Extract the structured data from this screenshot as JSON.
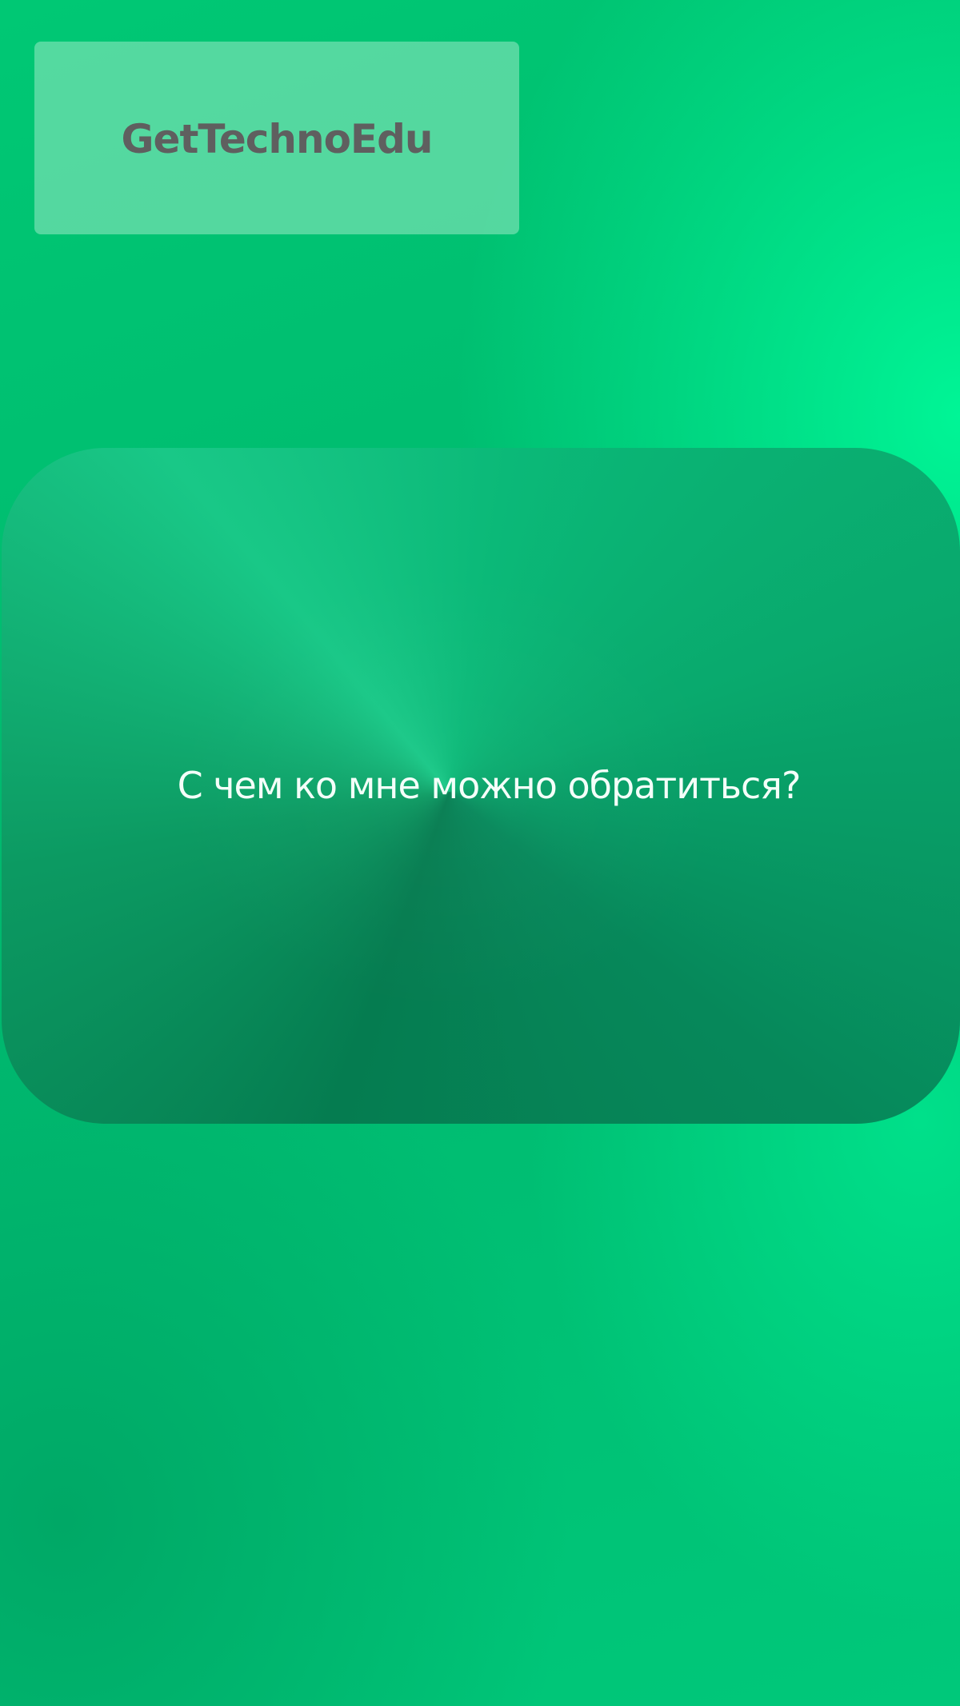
{
  "header": {
    "logo_text": "GetTechnoEdu"
  },
  "main": {
    "question_card": {
      "label": "С чем ко мне можно обратиться?"
    }
  }
}
